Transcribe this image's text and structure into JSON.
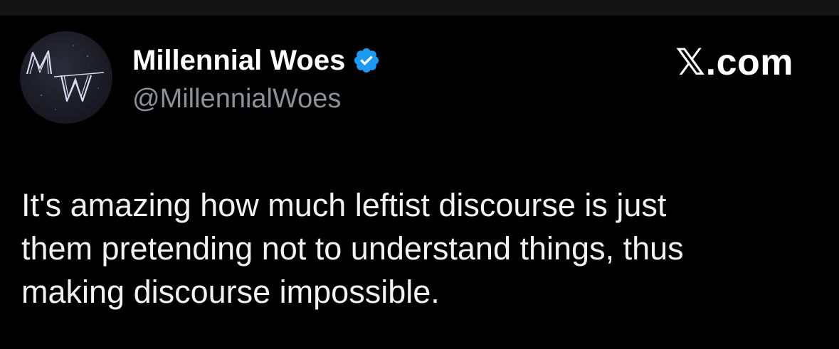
{
  "author": {
    "display_name": "Millennial Woes",
    "handle": "@MillennialWoes",
    "avatar_icon": "mw-monogram-avatar",
    "verified": true,
    "verified_icon": "verified-checkmark-icon"
  },
  "site": {
    "label": "𝕏.com"
  },
  "post": {
    "text": "It's amazing how much leftist discourse is just\nthem pretending not to understand things, thus\nmaking discourse impossible."
  },
  "colors": {
    "background": "#000000",
    "text_primary": "#ffffff",
    "text_secondary": "#8b9199",
    "verified_blue": "#1d9bf0"
  }
}
